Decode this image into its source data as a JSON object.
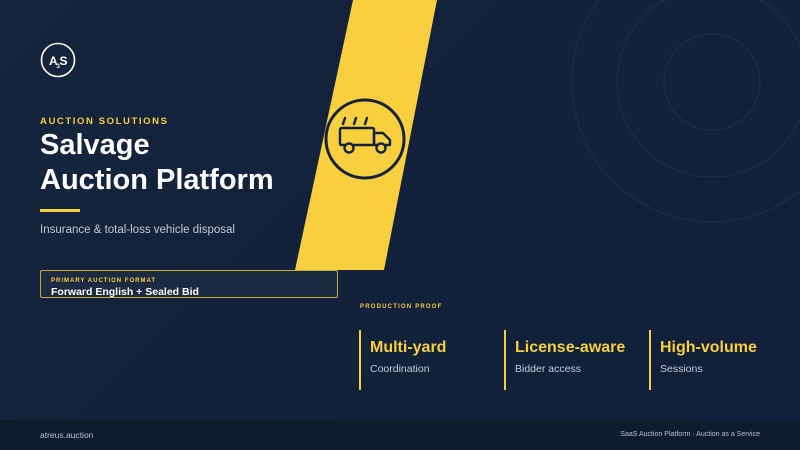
{
  "brand": {
    "logo_text": "AS",
    "logo_letters": [
      "A",
      "S"
    ],
    "logo_subscript": "3"
  },
  "hero": {
    "eyebrow": "AUCTION SOLUTIONS",
    "title_line1": "Salvage",
    "title_line2": "Auction Platform",
    "subtitle": "Insurance & total-loss vehicle disposal"
  },
  "format": {
    "label": "PRIMARY AUCTION FORMAT",
    "value": "Forward English + Sealed Bid"
  },
  "proof": {
    "heading": "PRODUCTION PROOF",
    "items": [
      {
        "title": "Multi-yard",
        "subtitle": "Coordination"
      },
      {
        "title": "License-aware",
        "subtitle": "Bidder access"
      },
      {
        "title": "High-volume",
        "subtitle": "Sessions"
      }
    ]
  },
  "footer": {
    "left": "atreus.auction",
    "right": "SaaS Auction Platform · Auction as a Service"
  },
  "icons": {
    "hero_icon": "tow-truck-icon",
    "logo_icon": "brand-logo-icon"
  },
  "colors": {
    "background": "#14233b",
    "accent": "#f7cf3f",
    "text": "#ffffff",
    "muted_text": "#c3cbd8",
    "footer_bg": "#0f1c30"
  }
}
